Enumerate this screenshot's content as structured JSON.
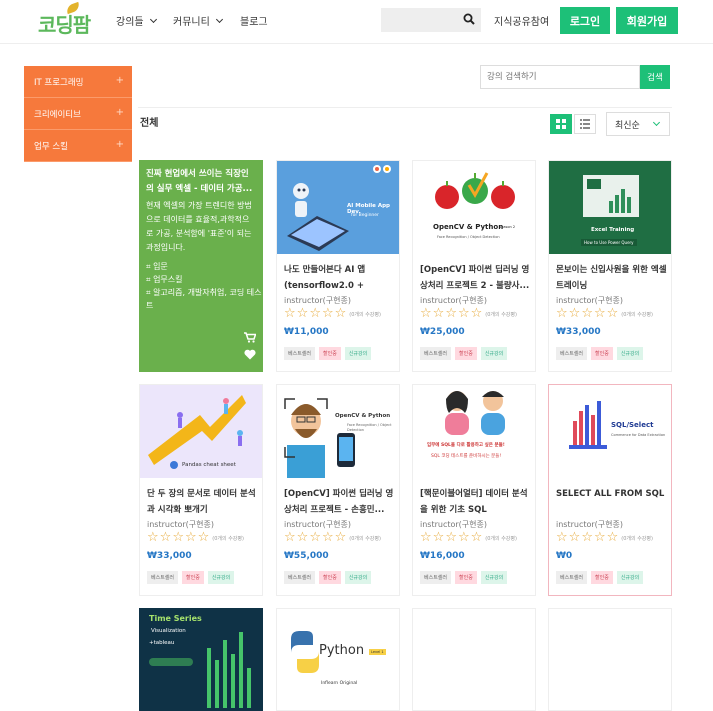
{
  "header": {
    "logo_text": "코딩팜",
    "nav": [
      {
        "label": "강의들"
      },
      {
        "label": "커뮤니티"
      },
      {
        "label": "블로그"
      }
    ],
    "share_link": "지식공유참여",
    "login_label": "로그인",
    "signup_label": "회원가입"
  },
  "sidebar": {
    "items": [
      {
        "label": "IT 프로그래밍"
      },
      {
        "label": "크리에이티브"
      },
      {
        "label": "업무 스킬"
      }
    ]
  },
  "course_search": {
    "placeholder": "강의 검색하기",
    "button": "검색"
  },
  "section": {
    "title": "전체",
    "sort": "최신순"
  },
  "promo": {
    "title": "진짜 현업에서 쓰이는 직장인의 실무 엑셀 - 데이터 가공...",
    "desc": "현재 엑셀의 가장 트렌디한 방법으로 데이터를 효율적,과학적으로 가공, 분석함에 '표준'이 되는 과정입니다.",
    "cat1": "입문",
    "cat2": "업무스킬",
    "cat3": "알고리즘, 개발자취업, 코딩 테스트"
  },
  "cards": [
    {
      "title": "나도 만들어본다 AI 앱 (tensorflow2.0 + android)",
      "instructor": "instructor(구현종)",
      "price": "₩11,000",
      "rating_text": "(0개의 수강평)",
      "thumb_label": "AI Mobile App Dev.",
      "thumb_sub": "for Beginner"
    },
    {
      "title": "[OpenCV] 파이썬 딥러닝 영상처리 프로젝트 2 - 불량사...",
      "instructor": "instructor(구현종)",
      "price": "₩25,000",
      "rating_text": "(0개의 수강평)",
      "thumb_label": "OpenCV & Python",
      "thumb_sub": "Season 2",
      "thumb_sub2": "Face Recognition / Object Detection"
    },
    {
      "title": "몬보이는 신입사원을 위한 엑셀 트레이닝",
      "instructor": "instructor(구현종)",
      "price": "₩33,000",
      "rating_text": "(0개의 수강평)",
      "thumb_label": "Excel Training",
      "thumb_sub": "How to Use Power Query"
    },
    {
      "title": "단 두 장의 문서로 데이터 분석과 시각화 뽀개기",
      "instructor": "instructor(구현종)",
      "price": "₩33,000",
      "rating_text": "(0개의 수강평)",
      "thumb_label": "Pandas cheat sheet"
    },
    {
      "title": "[OpenCV] 파이썬 딥러닝 영상처리 프로젝트 - 손흥민...",
      "instructor": "instructor(구현종)",
      "price": "₩55,000",
      "rating_text": "(0개의 수강평)",
      "thumb_label": "OpenCV & Python",
      "thumb_sub": "Face Recognition / Object Detection"
    },
    {
      "title": "[핵문이블어얼터] 데이터 분석을 위한 기초 SQL",
      "instructor": "instructor(구현종)",
      "price": "₩16,000",
      "rating_text": "(0개의 수강평)",
      "thumb_label": "입무에 SQL을 다로 활용하고 싶은 분들!",
      "thumb_sub": "SQL 코딩 테스트를 준비하시는 분들!"
    },
    {
      "title": "SELECT ALL FROM SQL",
      "instructor": "instructor(구현종)",
      "price": "₩0",
      "rating_text": "(0개의 수강평)",
      "thumb_label": "SQL/Select",
      "thumb_sub": "Commence for Data Extraction"
    },
    {
      "thumb_label": "Time Series",
      "thumb_sub": "Visualization",
      "thumb_sub2": "+tableau"
    },
    {
      "thumb_label": "Python",
      "thumb_sub": "Level 1",
      "thumb_sub2": "Inflearn Original"
    }
  ],
  "tags": {
    "best": "베스트셀러",
    "discount": "할인중",
    "new": "신규강의"
  }
}
